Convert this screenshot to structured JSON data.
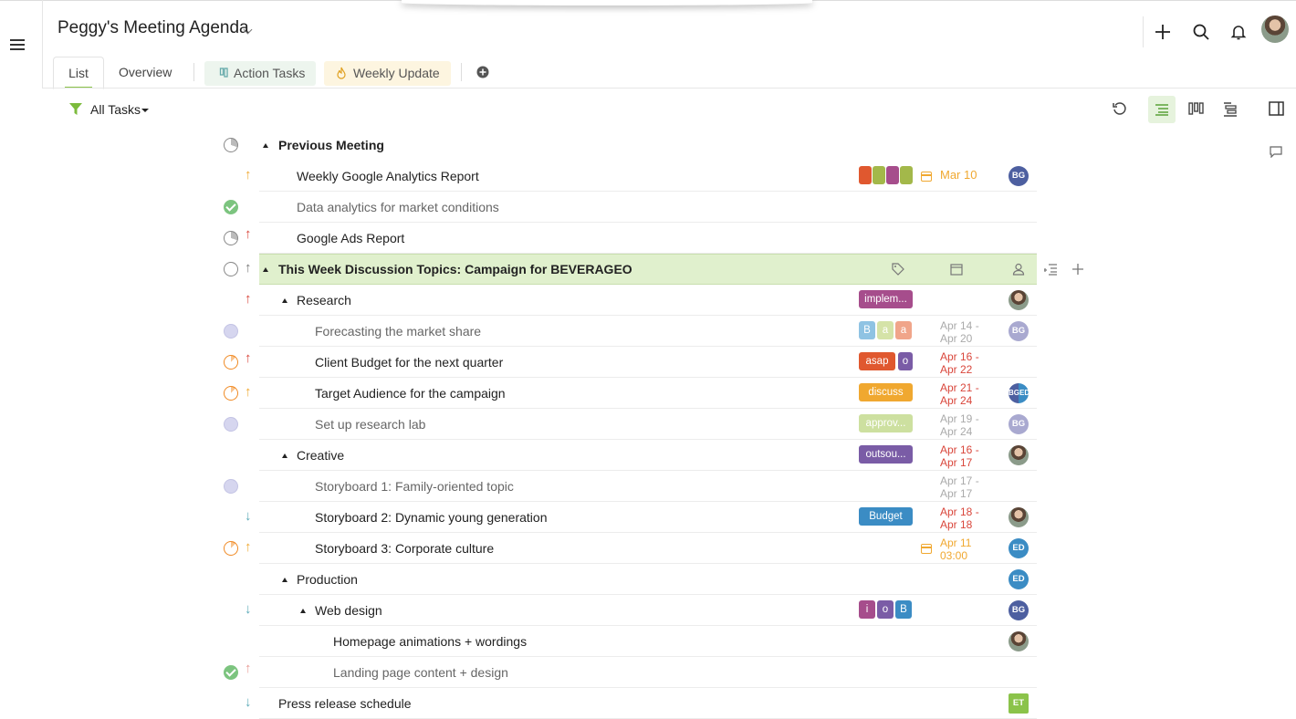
{
  "header": {
    "title": "Peggy's Meeting Agenda",
    "tabs": {
      "list": "List",
      "overview": "Overview",
      "action_tasks": "Action Tasks",
      "weekly_update": "Weekly Update"
    }
  },
  "toolbar": {
    "filter_label": "All Tasks"
  },
  "colors": {
    "accent_green": "#8bc34a",
    "highlight_row": "#e0f0cd",
    "overdue_red": "#d9463b",
    "due_orange": "#f0a830",
    "muted_gray": "#aaaaaa"
  },
  "rows": [
    {
      "name": "Previous Meeting"
    },
    {
      "name": "Weekly Google Analytics Report",
      "date": "Mar 10",
      "assignee": "BG"
    },
    {
      "name": "Data analytics for market conditions"
    },
    {
      "name": "Google Ads Report"
    },
    {
      "name": "This Week Discussion Topics: Campaign for BEVERAGEO"
    },
    {
      "name": "Research",
      "tags": [
        "implem..."
      ]
    },
    {
      "name": "Forecasting the market share",
      "tags": [
        "B",
        "a",
        "a"
      ],
      "date1": "Apr 14 -",
      "date2": "Apr 20",
      "assignee": "BG"
    },
    {
      "name": "Client Budget for the next quarter",
      "tags": [
        "asap",
        "o"
      ],
      "date1": "Apr 16 -",
      "date2": "Apr 22"
    },
    {
      "name": "Target Audience for the campaign",
      "tags": [
        "discuss"
      ],
      "date1": "Apr 21 -",
      "date2": "Apr 24",
      "assignee": "BGED"
    },
    {
      "name": "Set up research lab",
      "tags": [
        "approv..."
      ],
      "date1": "Apr 19 -",
      "date2": "Apr 24",
      "assignee": "BG"
    },
    {
      "name": "Creative",
      "tags": [
        "outsou..."
      ],
      "date1": "Apr 16 -",
      "date2": "Apr 17"
    },
    {
      "name": "Storyboard 1: Family-oriented topic",
      "date1": "Apr 17 -",
      "date2": "Apr 17"
    },
    {
      "name": "Storyboard 2: Dynamic young generation",
      "tags": [
        "Budget"
      ],
      "date1": "Apr 18 -",
      "date2": "Apr 18"
    },
    {
      "name": "Storyboard 3: Corporate culture",
      "date1": "Apr 11",
      "date2": "03:00",
      "assignee": "ED"
    },
    {
      "name": "Production",
      "assignee": "ED"
    },
    {
      "name": "Web design",
      "tags": [
        "i",
        "o",
        "B"
      ],
      "assignee": "BG"
    },
    {
      "name": "Homepage animations + wordings"
    },
    {
      "name": "Landing page content + design"
    },
    {
      "name": "Press release schedule",
      "assignee": "ET"
    }
  ]
}
